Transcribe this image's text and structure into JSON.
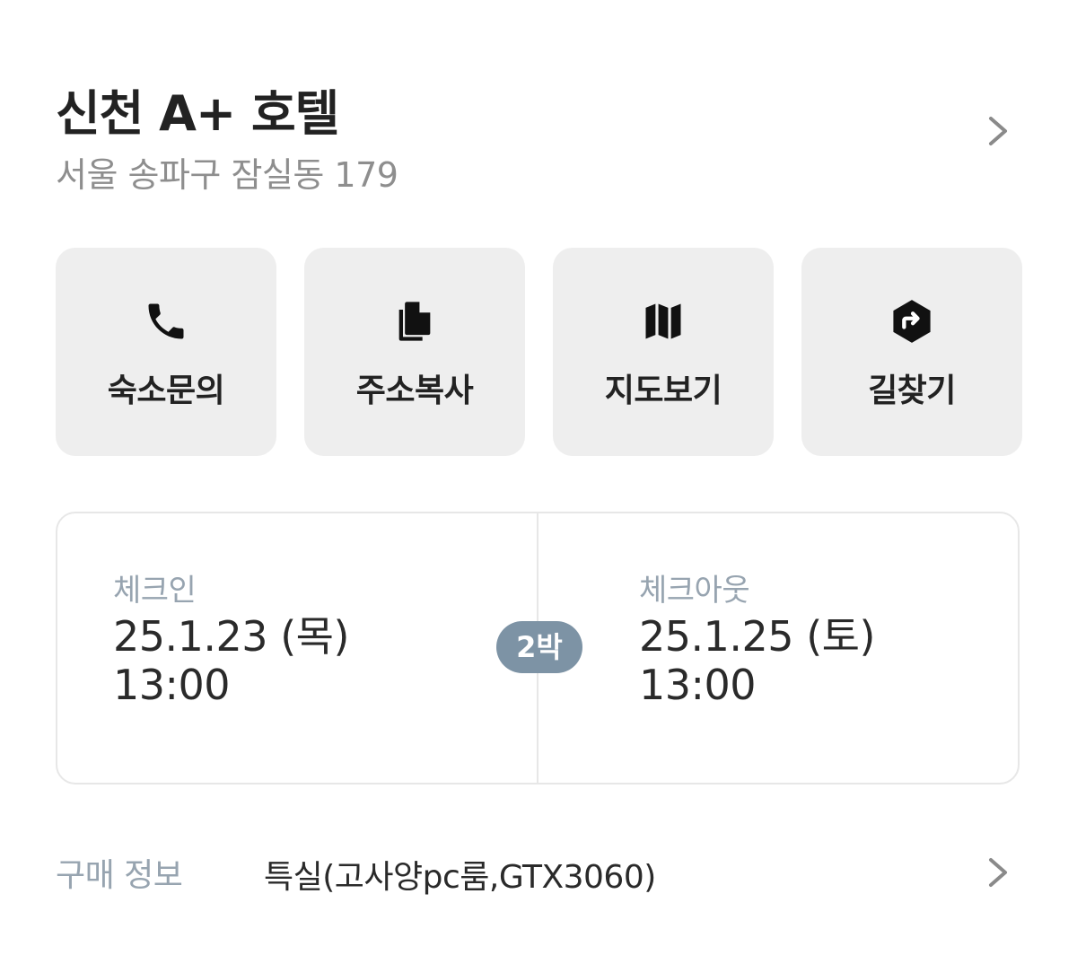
{
  "hotel": {
    "name": "신천 A+ 호텔",
    "address": "서울 송파구 잠실동 179",
    "detail_icon": "chevron-right-icon"
  },
  "actions": [
    {
      "label": "숙소문의",
      "icon": "phone-icon"
    },
    {
      "label": "주소복사",
      "icon": "copy-icon"
    },
    {
      "label": "지도보기",
      "icon": "map-icon"
    },
    {
      "label": "길찾기",
      "icon": "directions-icon"
    }
  ],
  "stay": {
    "checkin": {
      "label": "체크인",
      "date": "25.1.23 (목)",
      "time": "13:00"
    },
    "nights": "2박",
    "checkout": {
      "label": "체크아웃",
      "date": "25.1.25 (토)",
      "time": "13:00"
    }
  },
  "purchase": {
    "label": "구매 정보",
    "value": "특실(고사양pc룸,GTX3060)",
    "detail_icon": "chevron-right-icon"
  },
  "colors": {
    "button_bg": "#eeeeee",
    "muted_label": "#97a4b0",
    "badge_bg": "#7d93a5",
    "address_text": "#8e8e8e"
  }
}
